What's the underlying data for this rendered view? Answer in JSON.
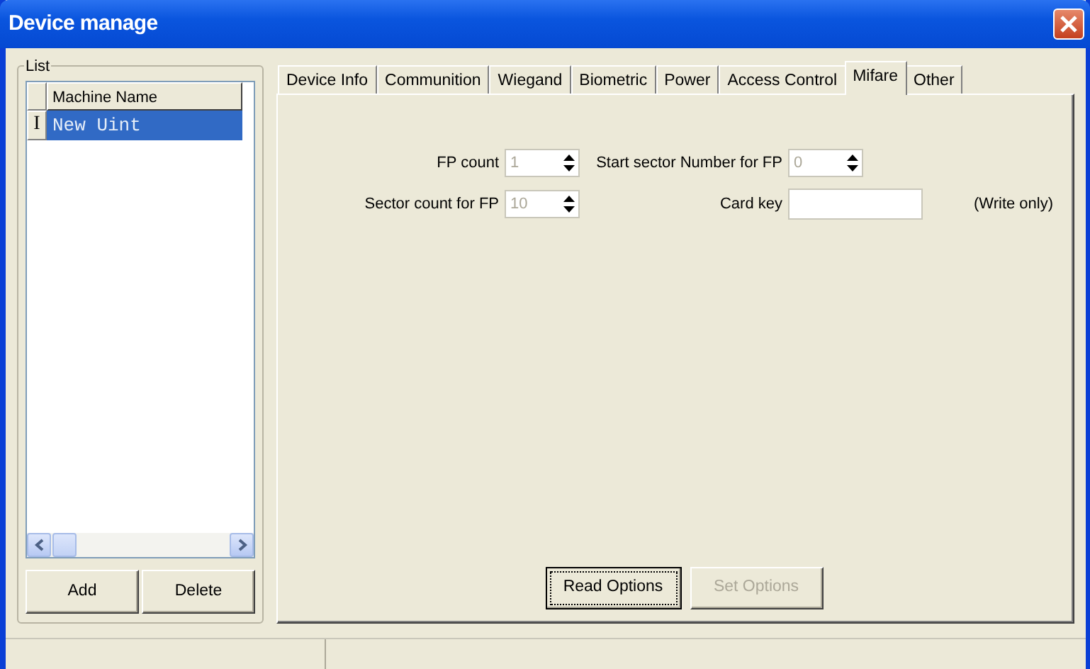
{
  "window": {
    "title": "Device manage"
  },
  "list": {
    "title": "List",
    "column": "Machine Name",
    "rows": [
      {
        "marker": "I",
        "name": "New Uint",
        "selected": true
      }
    ],
    "buttons": [
      {
        "label": "Add",
        "disabled": false
      },
      {
        "label": "Delete",
        "disabled": false
      }
    ]
  },
  "tabs": [
    {
      "label": "Device Info",
      "selected": false
    },
    {
      "label": "Communition",
      "selected": false
    },
    {
      "label": "Wiegand",
      "selected": false
    },
    {
      "label": "Biometric",
      "selected": false
    },
    {
      "label": "Power",
      "selected": false
    },
    {
      "label": "Access Control",
      "selected": false
    },
    {
      "label": "Mifare",
      "selected": true
    },
    {
      "label": "Other",
      "selected": false
    }
  ],
  "fields": [
    {
      "kind": "spin",
      "label": "FP count",
      "value": "1",
      "disabled": true
    },
    {
      "kind": "spin",
      "label": "Start sector Number for FP",
      "value": "0",
      "disabled": true
    },
    {
      "kind": "spin",
      "label": "Sector count for FP",
      "value": "10",
      "disabled": true
    },
    {
      "kind": "text",
      "label": "Card key",
      "note": "(Write only)"
    }
  ],
  "buttons": [
    {
      "label": "Read Options",
      "disabled": false,
      "focused": true
    },
    {
      "label": "Set Options",
      "disabled": true,
      "focused": false
    }
  ]
}
